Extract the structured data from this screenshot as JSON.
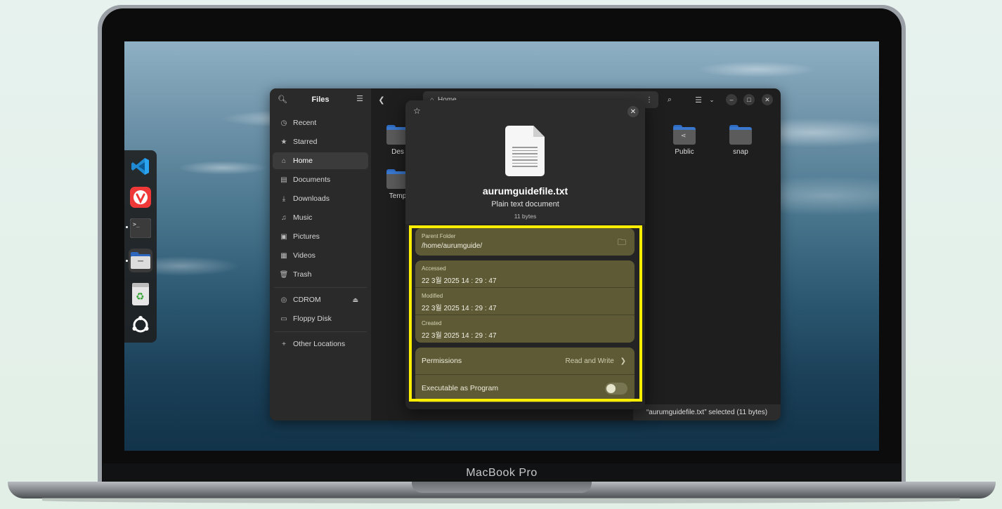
{
  "device": {
    "label": "MacBook Pro"
  },
  "dock": {
    "items": [
      {
        "name": "vscode",
        "icon": "vscode-icon"
      },
      {
        "name": "vivaldi",
        "icon": "vivaldi-icon"
      },
      {
        "name": "terminal",
        "icon": "terminal-icon"
      },
      {
        "name": "files",
        "icon": "folder-icon"
      },
      {
        "name": "trash",
        "icon": "recycle-bin-icon"
      },
      {
        "name": "show-apps",
        "icon": "ubuntu-logo-icon"
      }
    ]
  },
  "files_window": {
    "sidebar_title": "Files",
    "sidebar": {
      "places": [
        {
          "label": "Recent",
          "icon": "clock-icon"
        },
        {
          "label": "Starred",
          "icon": "star-icon"
        },
        {
          "label": "Home",
          "icon": "home-icon",
          "active": true
        },
        {
          "label": "Documents",
          "icon": "document-icon"
        },
        {
          "label": "Downloads",
          "icon": "download-icon"
        },
        {
          "label": "Music",
          "icon": "music-icon"
        },
        {
          "label": "Pictures",
          "icon": "picture-icon"
        },
        {
          "label": "Videos",
          "icon": "video-icon"
        },
        {
          "label": "Trash",
          "icon": "trash-icon"
        }
      ],
      "devices": [
        {
          "label": "CDROM",
          "icon": "disc-icon"
        },
        {
          "label": "Floppy Disk",
          "icon": "floppy-icon"
        }
      ],
      "other": {
        "label": "Other Locations",
        "icon": "plus-icon"
      }
    },
    "path": "Home",
    "folders": [
      {
        "label": "Des"
      },
      {
        "label": "Temp"
      },
      {
        "label": "Public"
      },
      {
        "label": "snap"
      }
    ],
    "status": "“aurumguidefile.txt” selected  (11 bytes)"
  },
  "properties": {
    "file_name": "aurumguidefile.txt",
    "file_type": "Plain text document",
    "file_size": "11 bytes",
    "parent_folder_label": "Parent Folder",
    "parent_folder_value": "/home/aurumguide/",
    "accessed_label": "Accessed",
    "accessed_value": "22 3월 2025 14 : 29 : 47",
    "modified_label": "Modified",
    "modified_value": "22 3월 2025 14 : 29 : 47",
    "created_label": "Created",
    "created_value": "22 3월 2025 14 : 29 : 47",
    "permissions_label": "Permissions",
    "permissions_value": "Read and Write",
    "executable_label": "Executable as Program",
    "executable_enabled": false
  },
  "colors": {
    "highlight": "#ffee00",
    "card_tint": "#5d5a35"
  }
}
